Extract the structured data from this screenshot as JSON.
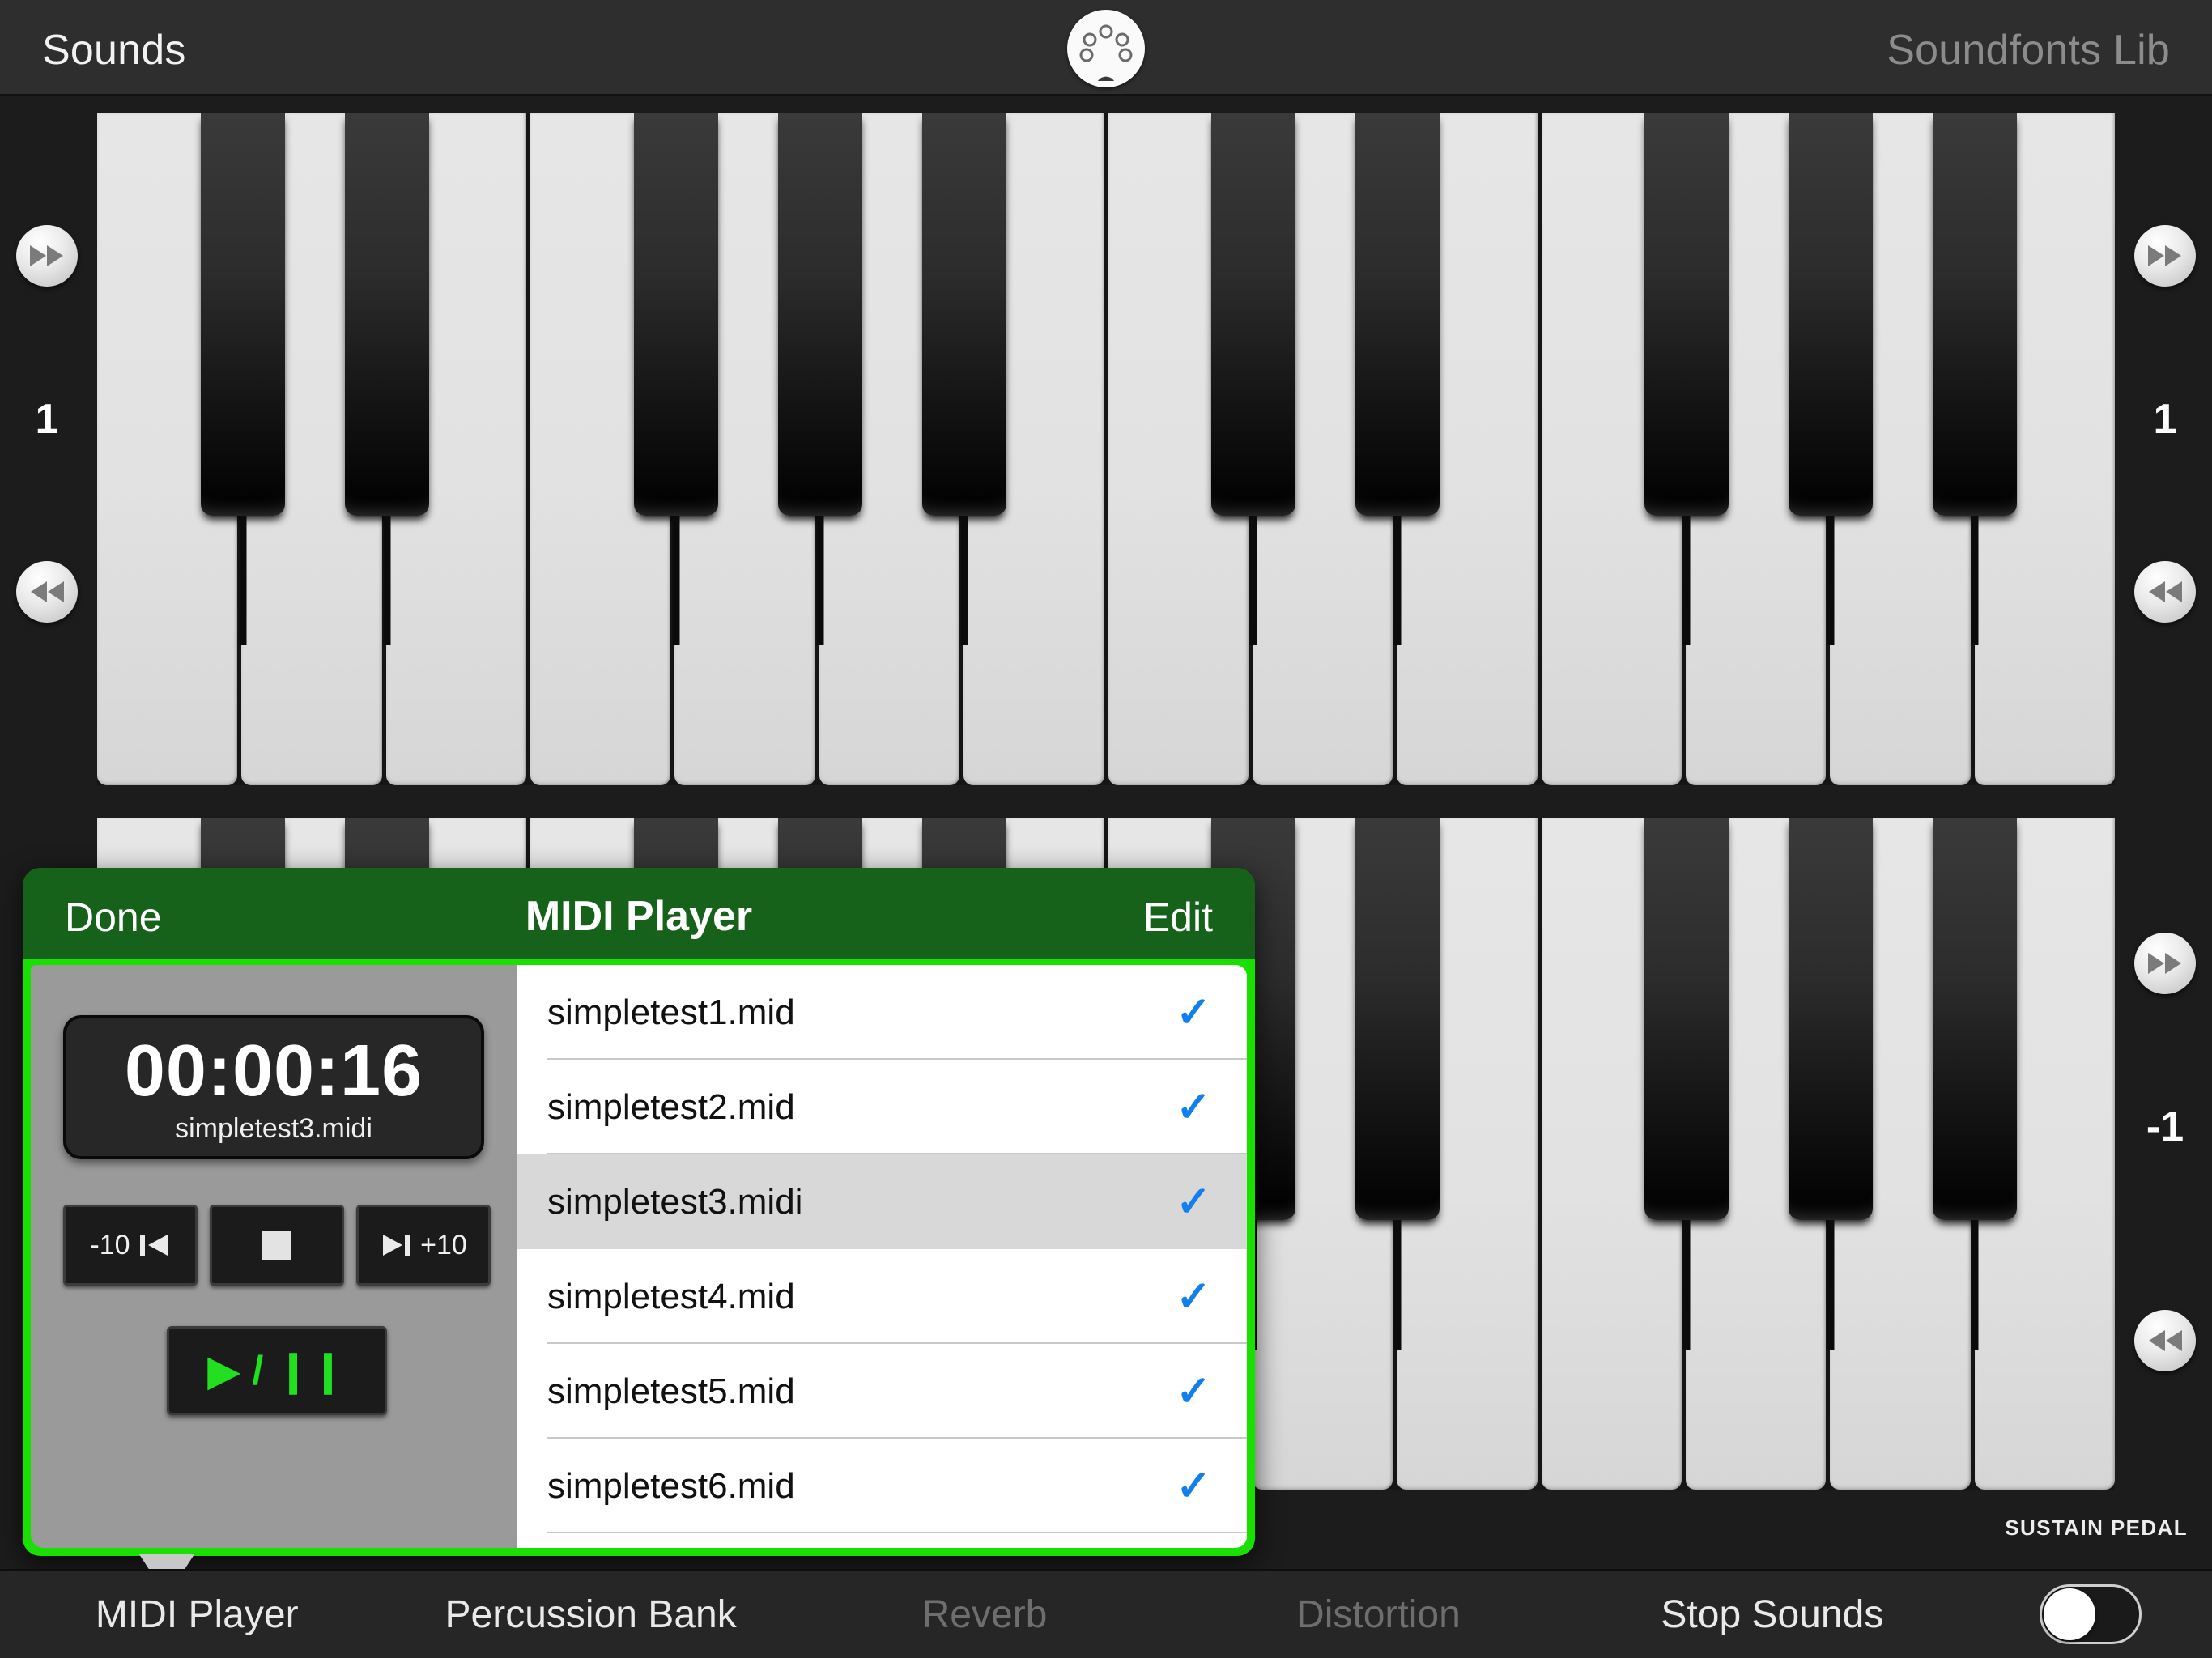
{
  "topbar": {
    "left_label": "Sounds",
    "right_label": "Soundfonts Lib",
    "center_icon": "midi-din-icon"
  },
  "keyboards": [
    {
      "name": "upper-keyboard",
      "octave": "1",
      "white_keys": 14,
      "up_icon": "fast-forward-icon",
      "down_icon": "rewind-icon"
    },
    {
      "name": "lower-keyboard",
      "octave": "-1",
      "white_keys": 14,
      "up_icon": "fast-forward-icon",
      "down_icon": "rewind-icon"
    }
  ],
  "sustain_pedal": {
    "label": "SUSTAIN PEDAL",
    "state": "off"
  },
  "bottom_toolbar": {
    "items": [
      {
        "label": "MIDI Player",
        "active": true,
        "dim": false
      },
      {
        "label": "Percussion Bank",
        "active": false,
        "dim": false
      },
      {
        "label": "Reverb",
        "active": false,
        "dim": true
      },
      {
        "label": "Distortion",
        "active": false,
        "dim": true
      },
      {
        "label": "Stop Sounds",
        "active": false,
        "dim": false
      }
    ],
    "toggle": {
      "name": "sustain-toggle",
      "state": "off"
    }
  },
  "popover": {
    "header": {
      "done": "Done",
      "title": "MIDI Player",
      "edit": "Edit"
    },
    "player": {
      "time": "00:00:16",
      "file": "simpletest3.midi",
      "back_label": "-10",
      "back_icon": "skip-back-icon",
      "stop_icon": "stop-square-icon",
      "forward_icon": "skip-forward-icon",
      "forward_label": "+10",
      "play_pause_label": "▶ / ❙❙"
    },
    "files": [
      {
        "name": "simpletest1.mid",
        "checked": true,
        "selected": false
      },
      {
        "name": "simpletest2.mid",
        "checked": true,
        "selected": false
      },
      {
        "name": "simpletest3.midi",
        "checked": true,
        "selected": true
      },
      {
        "name": "simpletest4.mid",
        "checked": true,
        "selected": false
      },
      {
        "name": "simpletest5.mid",
        "checked": true,
        "selected": false
      },
      {
        "name": "simpletest6.mid",
        "checked": true,
        "selected": false
      }
    ],
    "check_glyph": "✓"
  },
  "colors": {
    "accent_green": "#18e000",
    "header_green": "#17621a",
    "check_blue": "#127fef",
    "play_green": "#22e020"
  }
}
